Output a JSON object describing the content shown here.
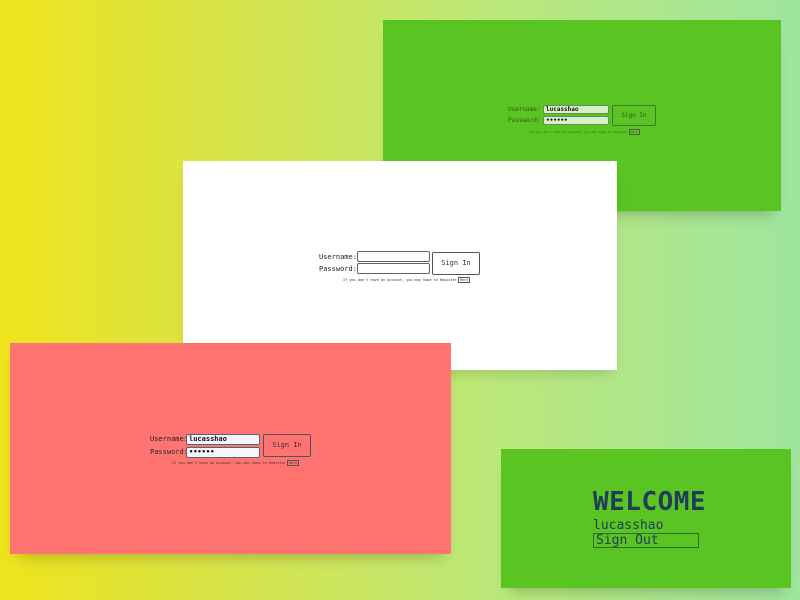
{
  "login_green": {
    "username_label": "Username:",
    "username_value": "lucasshao",
    "password_label": "Password:",
    "password_value": "••••••",
    "signin_label": "Sign In",
    "register_hint": "If you don't have an account, you may hope to Register",
    "here_label": "Here"
  },
  "login_white": {
    "username_label": "Username:",
    "username_value": "",
    "password_label": "Password:",
    "password_value": "",
    "signin_label": "Sign In",
    "register_hint": "If you don't have an account, you may hope to Register",
    "here_label": "Here"
  },
  "login_red": {
    "username_label": "Username:",
    "username_value": "lucasshao",
    "password_label": "Password:",
    "password_value": "••••••",
    "signin_label": "Sign In",
    "register_hint": "If you don't have an account, you may hope to Register",
    "here_label": "Here"
  },
  "welcome": {
    "title": "WELCOME",
    "username": "lucasshao",
    "signout_label": "Sign Out"
  },
  "colors": {
    "gradient_left": "#eee41c",
    "gradient_right": "#9fe59f",
    "green_panel": "#59c422",
    "red_panel": "#ff7470",
    "white_panel": "#ffffff",
    "text_dark": "#1f3d5a"
  }
}
